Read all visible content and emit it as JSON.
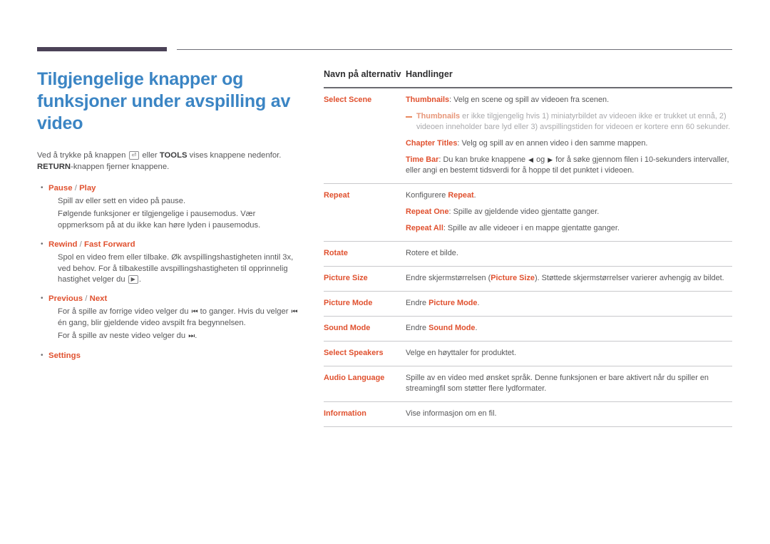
{
  "colors": {
    "heading_blue": "#3b85c4",
    "accent_orange": "#e0512f",
    "rule_purple": "#4b4257",
    "body_grey": "#58585a",
    "note_grey": "#a9a9ac"
  },
  "page": {
    "title": "Tilgjengelige knapper og funksjoner under avspilling av video",
    "intro": {
      "part1": "Ved å trykke på knappen ",
      "icon1": "enter-key-icon",
      "part2": " eller ",
      "bold1": "TOOLS",
      "part3": " vises knappene nedenfor. ",
      "bold2": "RETURN",
      "part4": "-knappen fjerner knappene."
    },
    "bullets": [
      {
        "term": "Pause",
        "separator": " / ",
        "term2": "Play",
        "paragraphs": [
          "Spill av eller sett en video på pause.",
          "Følgende funksjoner er tilgjengelige i pausemodus. Vær oppmerksom på at du ikke kan høre lyden i pausemodus."
        ]
      },
      {
        "term": "Rewind",
        "separator": " / ",
        "term2": "Fast Forward",
        "paragraphs": [
          "Spol en video frem eller tilbake. Øk avspillingshastigheten inntil 3x, ved behov. For å tilbakestille avspillingshastigheten til opprinnelig hastighet velger du ⏵."
        ]
      },
      {
        "term": "Previous",
        "separator": " / ",
        "term2": "Next",
        "paragraphs": [
          "For å spille av forrige video velger du ⏮ to ganger. Hvis du velger ⏮ én gang, blir gjeldende video avspilt fra begynnelsen.",
          "For å spille av neste video velger du ⏭."
        ]
      },
      {
        "term": "Settings",
        "separator": "",
        "term2": "",
        "paragraphs": []
      }
    ]
  },
  "table": {
    "headers": {
      "col_a": "Navn på alternativ",
      "col_b": "Handlinger"
    },
    "rows": [
      {
        "label": "Select Scene",
        "lines": [
          {
            "type": "text",
            "bold": "Thumbnails",
            "rest": ": Velg en scene og spill av videoen fra scenen."
          },
          {
            "type": "note",
            "bold": "Thumbnails",
            "rest": " er ikke tilgjengelig hvis 1) miniatyrbildet av videoen ikke er trukket ut ennå, 2) videoen inneholder bare lyd eller 3) avspillingstiden for videoen er kortere enn 60 sekunder."
          },
          {
            "type": "text",
            "bold": "Chapter Titles",
            "rest": ": Velg og spill av en annen video i den samme mappen."
          },
          {
            "type": "timebar",
            "bold": "Time Bar",
            "rest_a": ": Du kan bruke knappene ",
            "arrow_left": "◀",
            "mid": " og ",
            "arrow_right": "▶",
            "rest_b": " for å søke gjennom filen i 10-sekunders intervaller, eller angi en bestemt tidsverdi for å hoppe til det punktet i videoen."
          }
        ]
      },
      {
        "label": "Repeat",
        "lines": [
          {
            "type": "prefix",
            "pre": "Konfigurere ",
            "bold": "Repeat",
            "rest": "."
          },
          {
            "type": "text",
            "bold": "Repeat One",
            "rest": ": Spille av gjeldende video gjentatte ganger."
          },
          {
            "type": "text",
            "bold": "Repeat All",
            "rest": ": Spille av alle videoer i en mappe gjentatte ganger."
          }
        ]
      },
      {
        "label": "Rotate",
        "lines": [
          {
            "type": "plain",
            "rest": "Rotere et bilde."
          }
        ]
      },
      {
        "label": "Picture Size",
        "lines": [
          {
            "type": "mid-bold",
            "pre": "Endre skjermstørrelsen (",
            "bold": "Picture Size",
            "rest": "). Støttede skjermstørrelser varierer avhengig av bildet."
          }
        ]
      },
      {
        "label": "Picture Mode",
        "lines": [
          {
            "type": "prefix",
            "pre": "Endre ",
            "bold": "Picture Mode",
            "rest": "."
          }
        ]
      },
      {
        "label": "Sound Mode",
        "lines": [
          {
            "type": "prefix",
            "pre": "Endre ",
            "bold": "Sound Mode",
            "rest": "."
          }
        ]
      },
      {
        "label": "Select Speakers",
        "lines": [
          {
            "type": "plain",
            "rest": "Velge en høyttaler for produktet."
          }
        ]
      },
      {
        "label": "Audio Language",
        "lines": [
          {
            "type": "plain",
            "rest": "Spille av en video med ønsket språk. Denne funksjonen er bare aktivert når du spiller en streamingfil som støtter flere lydformater."
          }
        ]
      },
      {
        "label": "Information",
        "lines": [
          {
            "type": "plain",
            "rest": "Vise informasjon om en fil."
          }
        ]
      }
    ]
  }
}
